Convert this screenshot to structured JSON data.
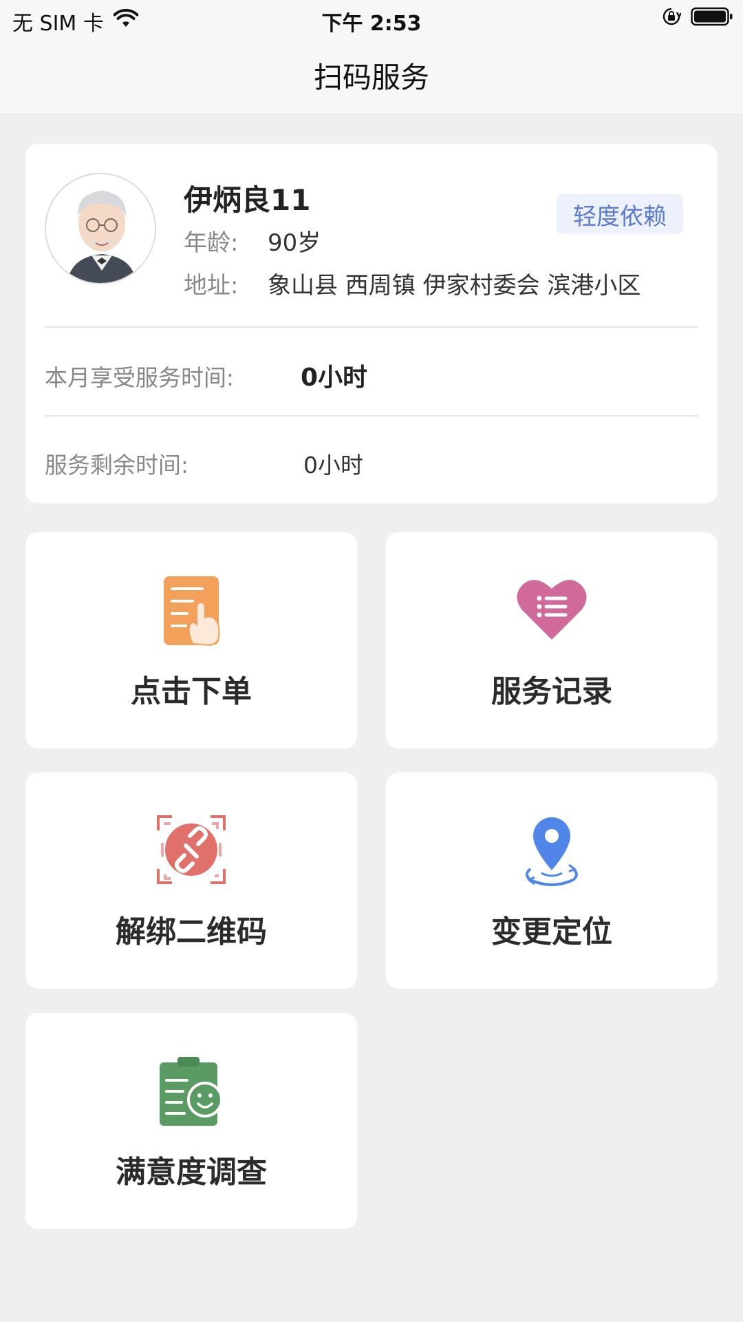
{
  "status_bar": {
    "carrier": "无 SIM 卡",
    "time": "下午 2:53",
    "icons": [
      "wifi-icon",
      "orientation-lock-icon",
      "battery-icon"
    ]
  },
  "nav": {
    "title": "扫码服务"
  },
  "profile": {
    "name": "伊炳良11",
    "age_label": "年龄:",
    "age_value": "90岁",
    "address_label": "地址:",
    "address_value": "象山县 西周镇 伊家村委会 滨港小区",
    "badge": "轻度依赖",
    "badge_color": "#5a7bd0",
    "monthly_service_label": "本月享受服务时间:",
    "monthly_service_value": "0小时",
    "remaining_service_label": "服务剩余时间:",
    "remaining_service_value": "0小时"
  },
  "tiles": [
    {
      "label": "点击下单",
      "icon": "order-tap-icon",
      "color": "#f3a05a"
    },
    {
      "label": "服务记录",
      "icon": "heart-list-icon",
      "color": "#d06a9a"
    },
    {
      "label": "解绑二维码",
      "icon": "unbind-qr-icon",
      "color": "#e0706a"
    },
    {
      "label": "变更定位",
      "icon": "location-pin-icon",
      "color": "#4f86e8"
    },
    {
      "label": "满意度调查",
      "icon": "survey-clipboard-icon",
      "color": "#5a9a63"
    }
  ]
}
